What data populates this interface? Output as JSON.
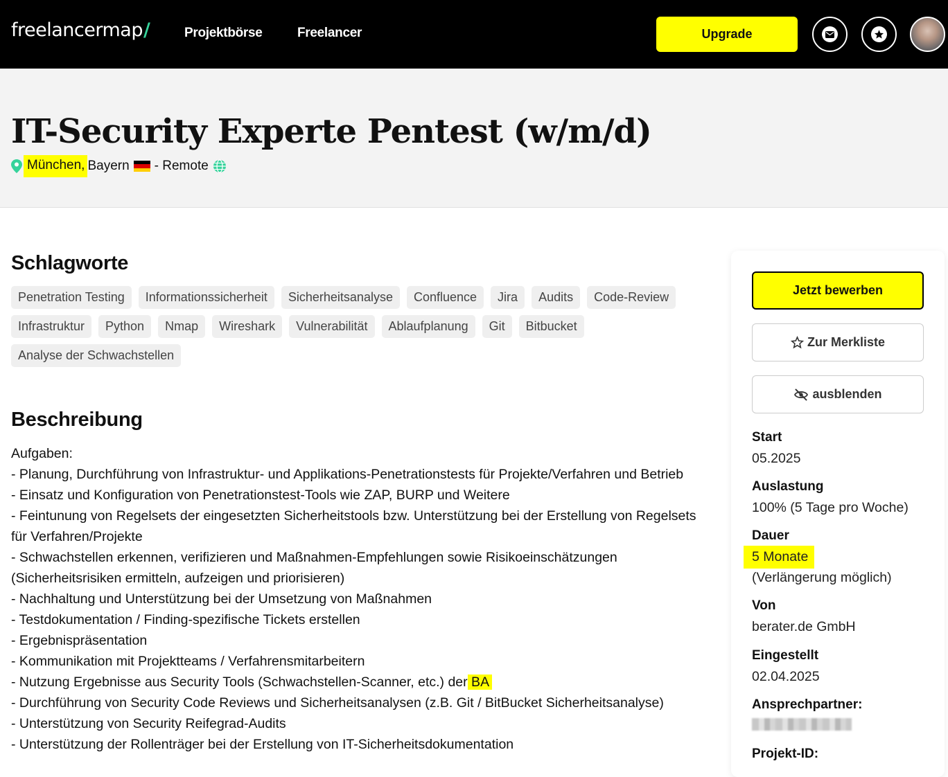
{
  "header": {
    "logo_text": "freelancermap",
    "logo_mark": "/",
    "nav": [
      "Projektbörse",
      "Freelancer"
    ],
    "upgrade_label": "Upgrade",
    "icons": [
      "mail-icon",
      "star-icon",
      "avatar"
    ]
  },
  "project": {
    "title": "IT-Security Experte Pentest (w/m/d)",
    "city": "München,",
    "region": "Bayern",
    "remote": "- Remote"
  },
  "tags_heading": "Schlagworte",
  "tags": [
    "Penetration Testing",
    "Informationssicherheit",
    "Sicherheitsanalyse",
    "Confluence",
    "Jira",
    "Audits",
    "Code-Review",
    "Infrastruktur",
    "Python",
    "Nmap",
    "Wireshark",
    "Vulnerabilität",
    "Ablaufplanung",
    "Git",
    "Bitbucket",
    "Analyse der Schwachstellen"
  ],
  "description_heading": "Beschreibung",
  "description": {
    "intro": "Aufgaben:",
    "lines": [
      "- Planung, Durchführung von Infrastruktur- und Applikations-Penetrationstests für Projekte/Verfahren und Betrieb",
      "- Einsatz und Konfiguration von Penetrationstest-Tools wie ZAP, BURP und Weitere",
      "- Feintunung von Regelsets der eingesetzten Sicherheitstools bzw. Unterstützung bei der Erstellung von Regelsets für Verfahren/Projekte",
      "- Schwachstellen erkennen, verifizieren und Maßnahmen-Empfehlungen sowie Risikoeinschätzungen (Sicherheitsrisiken ermitteln, aufzeigen und priorisieren)",
      "- Nachhaltung und Unterstützung bei der Umsetzung von Maßnahmen",
      "- Testdokumentation / Finding-spezifische Tickets erstellen",
      "- Ergebnispräsentation",
      "- Kommunikation mit Projektteams / Verfahrensmitarbeitern"
    ],
    "ba_line_prefix": "- Nutzung Ergebnisse aus Security Tools (Schwachstellen-Scanner, etc.) der",
    "ba_line_highlight": " BA ",
    "lines_after": [
      "- Durchführung von Security Code Reviews und Sicherheitsanalysen (z.B. Git / BitBucket Sicherheitsanalyse)",
      "- Unterstützung von Security Reifegrad-Audits",
      "- Unterstützung der Rollenträger bei der Erstellung von IT-Sicherheitsdokumentation"
    ]
  },
  "sidebar": {
    "apply_label": "Jetzt bewerben",
    "merkliste_label": "Zur Merkliste",
    "hide_label": "ausblenden",
    "start_label": "Start",
    "start_value": "05.2025",
    "auslastung_label": "Auslastung",
    "auslastung_value": "100% (5 Tage pro Woche)",
    "dauer_label": "Dauer",
    "dauer_value": "5 Monate",
    "dauer_note": "(Verlängerung möglich)",
    "von_label": "Von",
    "von_value": "berater.de GmbH",
    "eingestellt_label": "Eingestellt",
    "eingestellt_value": "02.04.2025",
    "ansprech_label": "Ansprechpartner:",
    "projektid_label": "Projekt-ID:"
  },
  "colors": {
    "accent_yellow": "#ffff00",
    "logo_green": "#36d39b",
    "header_bg": "#000000",
    "hero_bg": "#f3f3f3"
  }
}
